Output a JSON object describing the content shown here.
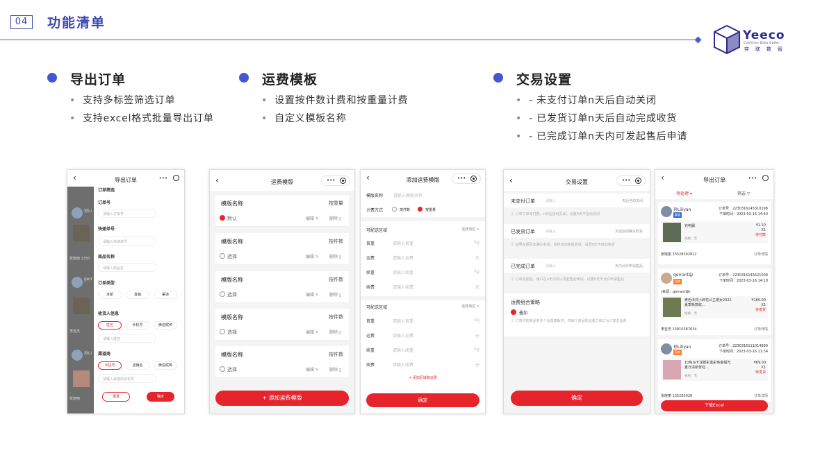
{
  "section": {
    "number": "04",
    "title": "功能清单"
  },
  "logo": {
    "word": "Yeeco",
    "tagline": "Coalition Data Game",
    "cn": "弈联数智"
  },
  "features": [
    {
      "title": "导出订单",
      "items": [
        "支持多标签筛选订单",
        "支持excel格式批量导出订单"
      ]
    },
    {
      "title": "运费模板",
      "items": [
        "设置按件数计费和按重量计费",
        "自定义模板名称"
      ]
    },
    {
      "title": "交易设置",
      "items": [
        "- 未支付订单n天后自动关闭",
        "- 已发货订单n天后自动完成收货",
        "- 已完成订单n天内可发起售后申请"
      ]
    }
  ],
  "phone_export": {
    "title": "导出订单",
    "capsule": "•••",
    "filter_title": "订单筛选",
    "fields": [
      {
        "label": "订单号",
        "placeholder": "请输入订单号"
      },
      {
        "label": "快递单号",
        "placeholder": "请输入快递单号"
      },
      {
        "label": "商品名称",
        "placeholder": "请输入商品名"
      }
    ],
    "type_label": "订单类型",
    "types": [
      "全新",
      "直销",
      "渠道"
    ],
    "receiver_label": "收货人信息",
    "receiver_opts": [
      "姓名",
      "手机号",
      "微信昵称"
    ],
    "receiver_ph": "请输入姓名",
    "channel_label": "渠道商",
    "channel_opts": [
      "手机号",
      "店铺名",
      "微信昵称"
    ],
    "channel_ph": "请输入渠道商手机号",
    "reset": "重置",
    "confirm": "确定",
    "bg_names": [
      "孙Li",
      "gerr",
      "孙Li"
    ],
    "bg_phones": [
      "张晓丽 1350",
      "李吉杰",
      "张晓丽"
    ]
  },
  "phone_template_list": {
    "title": "运费模版",
    "capsule": "•••",
    "cards": [
      {
        "name": "模版名称",
        "type": "按重量",
        "radio": "默认",
        "on": true,
        "edit": "编辑",
        "del": "删除"
      },
      {
        "name": "模版名称",
        "type": "按件数",
        "radio": "选择",
        "on": false,
        "edit": "编辑",
        "del": "删除"
      },
      {
        "name": "模版名称",
        "type": "按件数",
        "radio": "选择",
        "on": false,
        "edit": "编辑",
        "del": "删除"
      },
      {
        "name": "模版名称",
        "type": "按件数",
        "radio": "选择",
        "on": false,
        "edit": "编辑",
        "del": "删除"
      },
      {
        "name": "模版名称",
        "type": "按件数",
        "radio": "选择",
        "on": false,
        "edit": "编辑",
        "del": "删除"
      }
    ],
    "add_button": "+ 添加运费模版"
  },
  "phone_template_add": {
    "title": "添加运费模版",
    "capsule": "•••",
    "name_label": "模版名称",
    "name_ph": "请输入模版名称",
    "method_label": "计费方式",
    "method_a": "按件数",
    "method_b": "按重量",
    "region_label": "可配送区域",
    "region_action": "选择地区 >",
    "rows": [
      {
        "k": "首重",
        "ph": "请输入首重",
        "u": "kg"
      },
      {
        "k": "运费",
        "ph": "请输入运费",
        "u": "元"
      },
      {
        "k": "续重",
        "ph": "请输入续重",
        "u": "kg"
      },
      {
        "k": "续费",
        "ph": "请输入续费",
        "u": "元"
      }
    ],
    "add_region": "+ 添加区域和运费",
    "confirm": "确定"
  },
  "phone_trade": {
    "title": "交易设置",
    "capsule": "•••",
    "items": [
      {
        "label": "未支付订单",
        "ph": "请输入",
        "right": "天后自动关闭",
        "note": "订单下单未付款，n天后自动关闭，设置0天不自动关闭"
      },
      {
        "label": "已发货订单",
        "ph": "请输入",
        "right": "天后自动确认收货",
        "note": "如果在期间未确认收货，系统自动完成收货，设置0天不自动收货"
      },
      {
        "label": "已完成订单",
        "ph": "请输入",
        "right": "天内允许申请售后",
        "note": "订单完成后，用户在n天内可以发起售后申请，设置0天不允许申请售后"
      }
    ],
    "strategy_label": "运费组合策略",
    "strategy_opt": "叠加",
    "strategy_note": "订单中的商品有多个运费模板时，将每个商品的运费之和订为订单总运费",
    "confirm": "确定"
  },
  "phone_orders": {
    "title": "导出订单",
    "capsule": "•••",
    "tab_active": "待处理 ▾",
    "tab_filter": "筛选 ▽",
    "orders": [
      {
        "name": "孙Liliyan",
        "badge": "渠道",
        "order_no": "订单号：2230316145310198",
        "time": "下单时间：2023-03-16 14:40",
        "product": "充电器",
        "spec": "规格：无",
        "price": "¥1.10",
        "qty": "X1",
        "status": "待付款",
        "contact": "张晓丽 13528392822",
        "action": "订单详情"
      },
      {
        "name": "gerrant😄",
        "badge": "直销",
        "order_no": "订单号：2230316145621009",
        "time": "下单时间：2023-03-16 14:10",
        "source": "(来源：gerrant😄)",
        "product": "奇色法式小碎花公主裙女2022夏季新款收...",
        "spec": "规格：无",
        "price": "¥160.00",
        "qty": "X1",
        "status": "待发货",
        "contact": "李吉杰 13916387634",
        "action": "订单详情"
      },
      {
        "name": "孙Liliyan",
        "badge": "直销",
        "order_no": "订单号：2230316111014899",
        "time": "下单时间：2023-03-16 11:34",
        "product": "10色马卡龙颜彩盒彩色金缎光夏日清新背虹...",
        "spec": "规格：无",
        "price": "¥69.00",
        "qty": "X1",
        "status": "待发货",
        "contact": "张晓丽 135283928",
        "action": "订单详情"
      }
    ],
    "download": "下载Excel"
  },
  "colors": {
    "accent": "#3a47b5",
    "dot": "#4457d1",
    "red": "#e5242c",
    "orange": "#ff7a2e"
  }
}
